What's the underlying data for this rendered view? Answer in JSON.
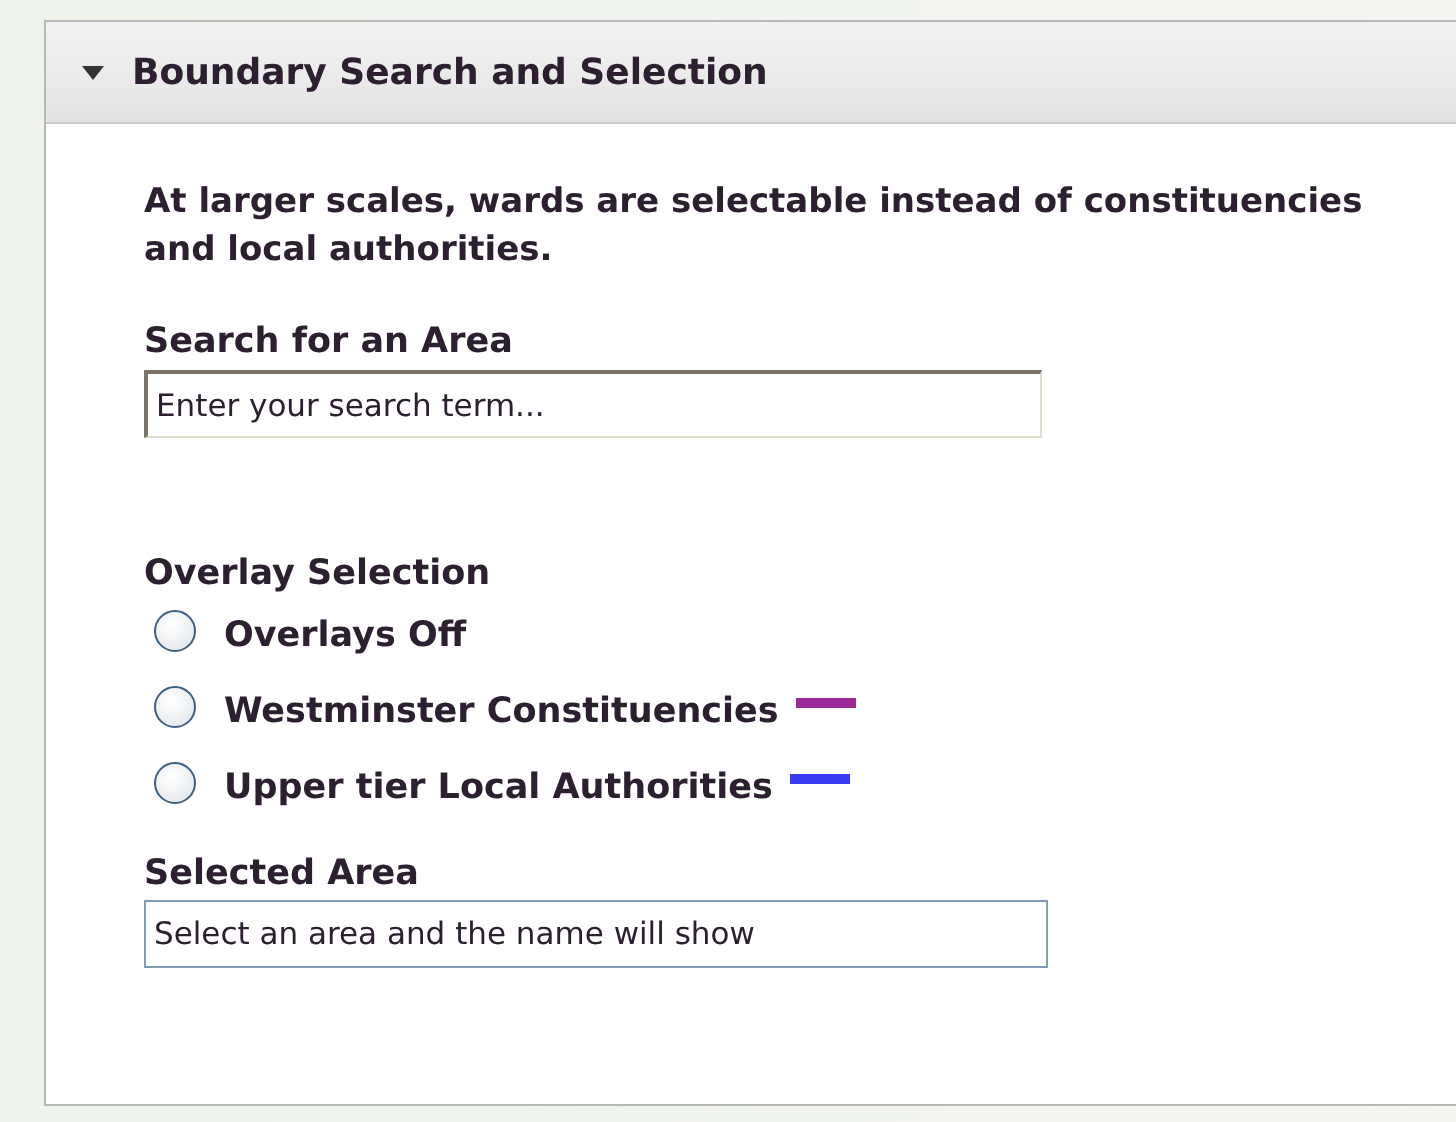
{
  "panel": {
    "title": "Boundary Search and Selection",
    "expanded": true
  },
  "note": "At larger scales, wards are selectable instead of constituencies and local authorities.",
  "search": {
    "label": "Search for an Area",
    "placeholder": "Enter your search term..."
  },
  "overlay": {
    "label": "Overlay Selection",
    "options": [
      {
        "label": "Overlays Off",
        "selected": false
      },
      {
        "label": "Westminster Constituencies",
        "selected": false,
        "color": "#9b2a96"
      },
      {
        "label": "Upper tier Local Authorities",
        "selected": false,
        "color": "#3b3bf5"
      }
    ]
  },
  "selected_area": {
    "label": "Selected Area",
    "value": "Select an area and the name will show"
  }
}
